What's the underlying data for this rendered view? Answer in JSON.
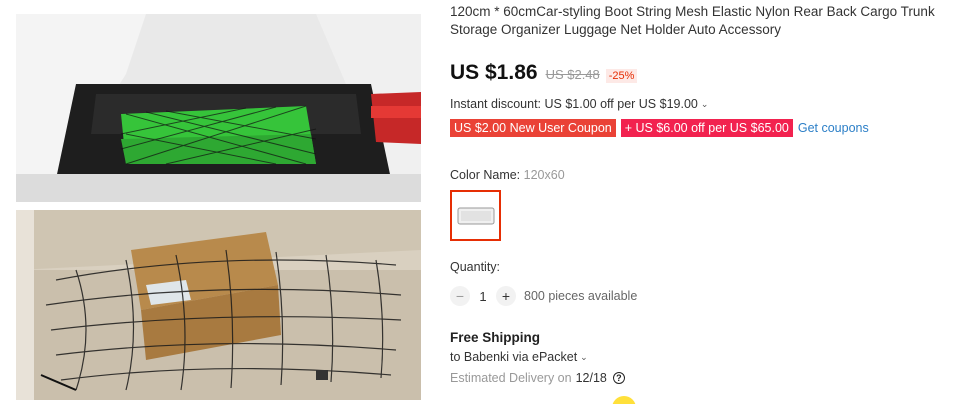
{
  "product": {
    "title": "120cm * 60cmCar-styling Boot String Mesh Elastic Nylon Rear Back Cargo Trunk Storage Organizer Luggage Net Holder Auto Accessory",
    "price": "US $1.86",
    "original_price": "US $2.48",
    "discount": "-25%",
    "instant_discount": "Instant discount: US $1.00 off per US $19.00",
    "coupons": [
      "US $2.00 New User Coupon",
      "+ US $6.00 off per US $65.00"
    ],
    "get_coupons": "Get coupons"
  },
  "variant": {
    "label": "Color Name:",
    "selected": "120x60"
  },
  "quantity": {
    "label": "Quantity:",
    "minus": "−",
    "value": "1",
    "plus": "+",
    "available": "800 pieces available"
  },
  "shipping": {
    "title": "Free Shipping",
    "to": "to Babenki via ePacket",
    "delivery_label": "Estimated Delivery on",
    "delivery_date": "12/18",
    "help_glyph": "?"
  },
  "icons": {
    "dropdown": "chevron-down-icon",
    "help": "question-circle-icon"
  },
  "colors": {
    "price_red": "#e62e04",
    "coupon_red": "#ea4236",
    "coupon_pink": "#f2224f",
    "link_blue": "#2c7fc7"
  }
}
